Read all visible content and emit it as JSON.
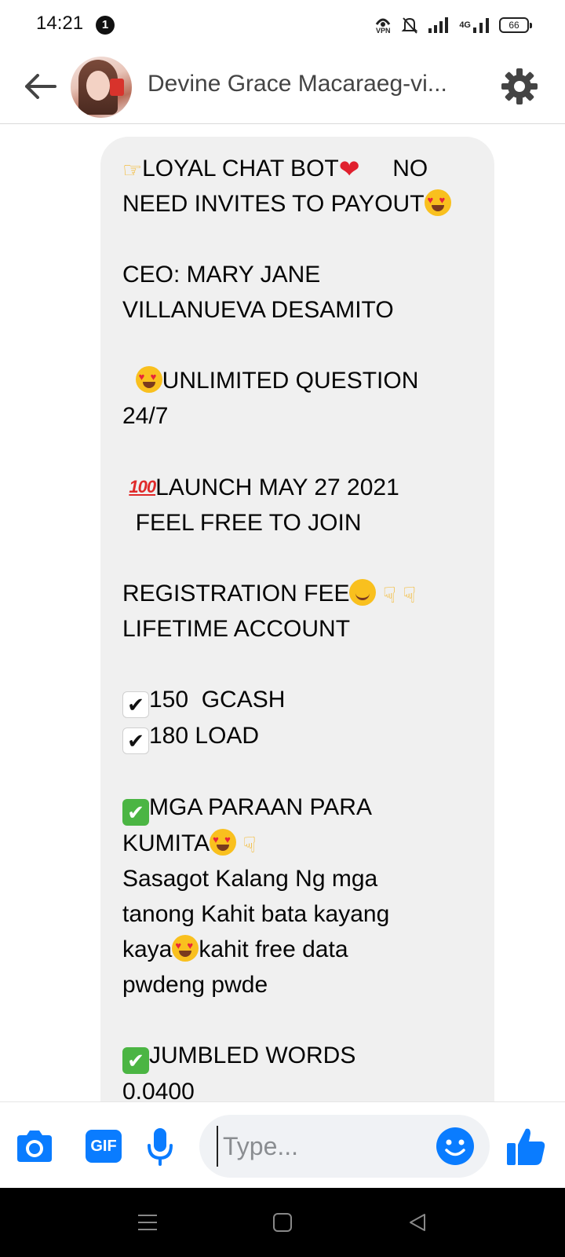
{
  "status_bar": {
    "time": "14:21",
    "notification_count": "1",
    "vpn_label": "VPN",
    "network_label": "4G",
    "battery_level": "66"
  },
  "header": {
    "contact_name": "Devine Grace Macaraeg-vi..."
  },
  "message": {
    "lines": [
      "LOYAL CHAT BOT",
      "NO",
      "NEED INVITES TO PAYOUT",
      "CEO: MARY JANE",
      "VILLANUEVA DESAMITO",
      "UNLIMITED QUESTION",
      "24/7",
      "LAUNCH MAY 27 2021",
      "FEEL FREE TO JOIN",
      "REGISTRATION FEE",
      "LIFETIME ACCOUNT",
      "150  GCASH",
      "180 LOAD",
      "MGA PARAAN PARA",
      "KUMITA",
      "Sasagot Kalang Ng mga",
      "tanong Kahit bata kayang",
      "kaya",
      "kahit free data",
      "pwdeng pwde",
      "JUMBLED WORDS",
      "0.0400"
    ]
  },
  "composer": {
    "placeholder": "Type...",
    "gif_label": "GIF"
  },
  "colors": {
    "accent": "#0a7cff",
    "bubble": "#f0f0f0"
  },
  "icons": [
    "back-arrow-icon",
    "gear-icon",
    "camera-icon",
    "gif-icon",
    "microphone-icon",
    "smiley-icon",
    "thumbs-up-icon"
  ]
}
